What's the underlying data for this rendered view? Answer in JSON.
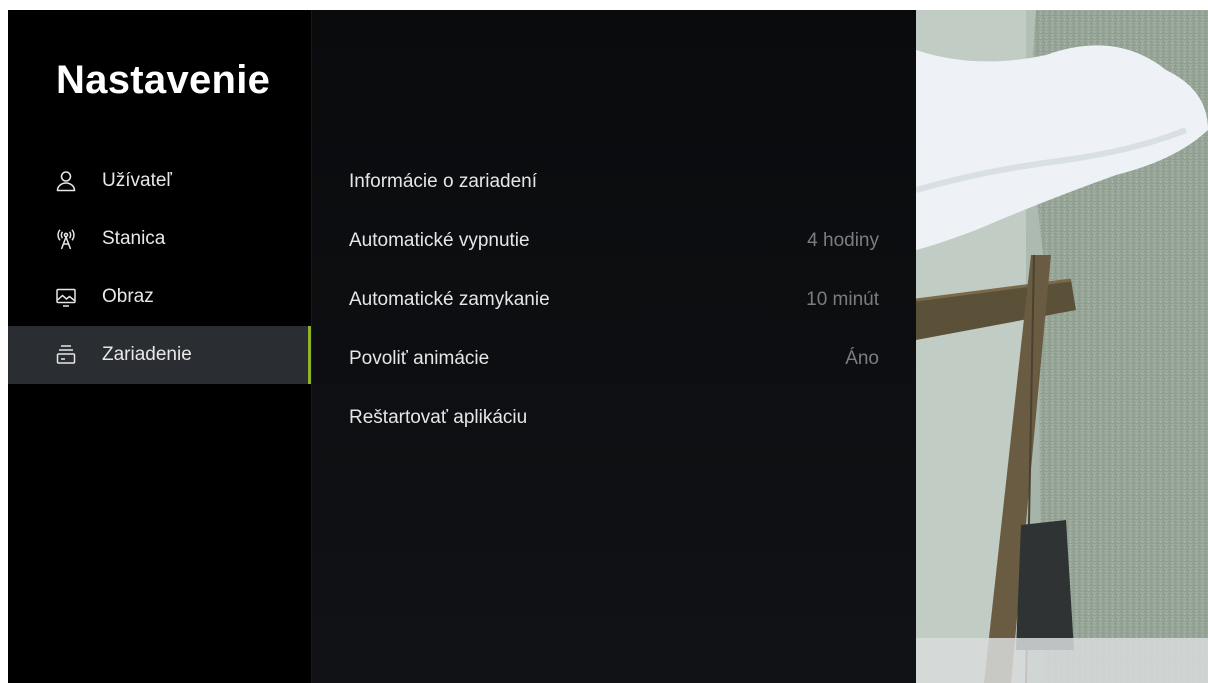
{
  "sidebar": {
    "title": "Nastavenie",
    "items": [
      {
        "label": "Užívateľ",
        "icon": "user-icon",
        "active": false
      },
      {
        "label": "Stanica",
        "icon": "antenna-icon",
        "active": false
      },
      {
        "label": "Obraz",
        "icon": "picture-icon",
        "active": false
      },
      {
        "label": "Zariadenie",
        "icon": "device-icon",
        "active": true
      }
    ]
  },
  "settings": [
    {
      "label": "Informácie o zariadení",
      "value": ""
    },
    {
      "label": "Automatické vypnutie",
      "value": "4 hodiny"
    },
    {
      "label": "Automatické zamykanie",
      "value": "10 minút"
    },
    {
      "label": "Povoliť animácie",
      "value": "Áno"
    },
    {
      "label": "Reštartovať aplikáciu",
      "value": ""
    }
  ],
  "colors": {
    "accent": "#8fb22a",
    "active_bg": "#2a2d31",
    "value_text": "#7b7d80"
  }
}
